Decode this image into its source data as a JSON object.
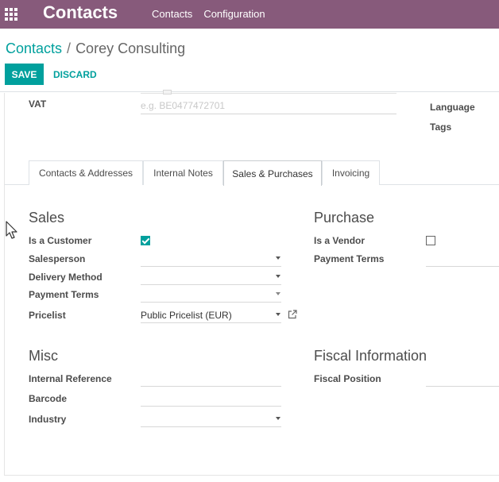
{
  "navbar": {
    "app_title": "Contacts",
    "menu": [
      "Contacts",
      "Configuration"
    ],
    "icons": {
      "apps": "apps-grid-icon"
    }
  },
  "control_panel": {
    "breadcrumb_root": "Contacts",
    "breadcrumb_separator": "/",
    "breadcrumb_current": "Corey Consulting",
    "save_label": "SAVE",
    "discard_label": "DISCARD"
  },
  "header_fields": {
    "vat_label": "VAT",
    "vat_placeholder": "e.g. BE0477472701",
    "language_label": "Language",
    "tags_label": "Tags"
  },
  "tabs": [
    "Contacts & Addresses",
    "Internal Notes",
    "Sales & Purchases",
    "Invoicing"
  ],
  "active_tab": "Sales & Purchases",
  "sales": {
    "title": "Sales",
    "is_customer_label": "Is a Customer",
    "is_customer": true,
    "salesperson_label": "Salesperson",
    "salesperson_value": "",
    "delivery_method_label": "Delivery Method",
    "delivery_method_value": "",
    "payment_terms_label": "Payment Terms",
    "payment_terms_value": "",
    "pricelist_label": "Pricelist",
    "pricelist_value": "Public Pricelist (EUR)"
  },
  "purchase": {
    "title": "Purchase",
    "is_vendor_label": "Is a Vendor",
    "is_vendor": false,
    "payment_terms_label": "Payment Terms",
    "payment_terms_value": ""
  },
  "misc": {
    "title": "Misc",
    "internal_reference_label": "Internal Reference",
    "barcode_label": "Barcode",
    "industry_label": "Industry"
  },
  "fiscal": {
    "title": "Fiscal Information",
    "fiscal_position_label": "Fiscal Position"
  },
  "colors": {
    "navbar": "#875a7b",
    "accent": "#00a09d"
  }
}
